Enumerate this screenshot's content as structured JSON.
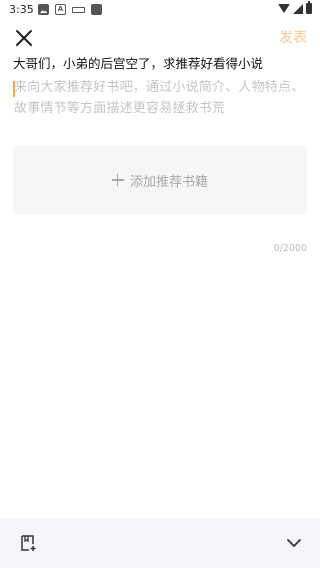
{
  "status_bar": {
    "time": "3:35",
    "left_icons": [
      "image-icon",
      "a-icon",
      "keyboard-icon",
      "square-icon"
    ],
    "right_icons": [
      "wifi-icon",
      "signal-icon",
      "battery-icon"
    ]
  },
  "header": {
    "publish_label": "发表",
    "publish_color": "#f3c995"
  },
  "post": {
    "title": "大哥们，小弟的后宫空了，求推荐好看得小说",
    "body_placeholder": "来向大家推荐好书吧，通过小说简介、人物特点、故事情节等方面描述更容易拯救书荒",
    "cursor_color": "#f7a35c"
  },
  "add_book": {
    "label": "添加推荐书籍"
  },
  "char_count": "0/2000",
  "bottom_bar": {
    "icons": [
      "add-book-icon",
      "chevron-down-icon"
    ]
  }
}
